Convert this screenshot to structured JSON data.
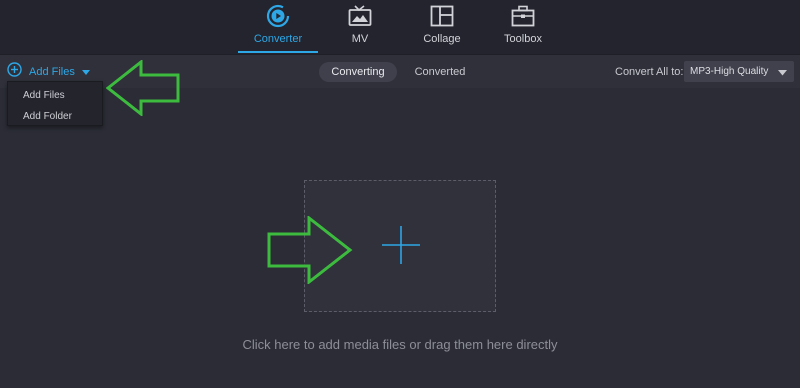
{
  "nav": {
    "tabs": [
      {
        "label": "Converter",
        "icon": "converter-icon",
        "active": true
      },
      {
        "label": "MV",
        "icon": "tv-icon",
        "active": false
      },
      {
        "label": "Collage",
        "icon": "collage-icon",
        "active": false
      },
      {
        "label": "Toolbox",
        "icon": "toolbox-icon",
        "active": false
      }
    ]
  },
  "toolbar": {
    "add_files_label": "Add Files",
    "subtabs": [
      {
        "label": "Converting",
        "active": true
      },
      {
        "label": "Converted",
        "active": false
      }
    ],
    "convert_all_label": "Convert All to:",
    "quality_value": "MP3-High Quality"
  },
  "menu": {
    "items": [
      {
        "label": "Add Files"
      },
      {
        "label": "Add Folder"
      }
    ]
  },
  "dropzone": {
    "hint": "Click here to add media files or drag them here directly"
  },
  "colors": {
    "accent": "#2ea7e6",
    "annotation_arrow": "#3dbb3f",
    "background": "#2b2c36"
  }
}
